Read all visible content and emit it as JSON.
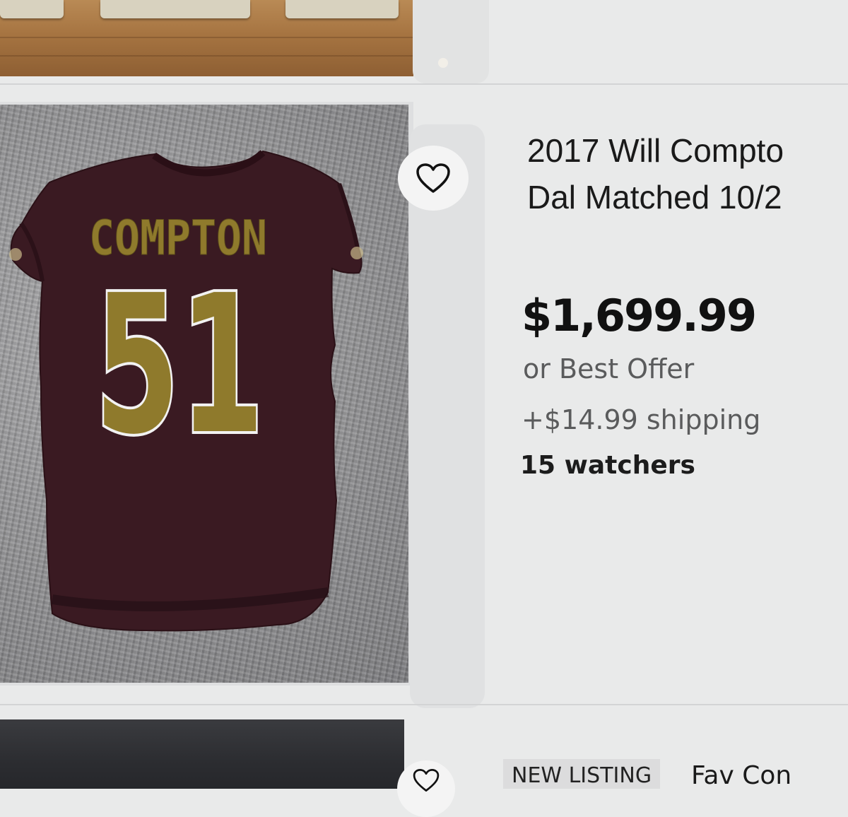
{
  "listing": {
    "title_line1": "2017 Will Compto",
    "title_line2": "Dal Matched 10/2",
    "price": "$1,699.99",
    "offer": "or Best Offer",
    "shipping": "+$14.99 shipping",
    "watchers": "15 watchers",
    "jersey_name": "COMPTON",
    "jersey_number": "51"
  },
  "next_listing": {
    "badge": "NEW LISTING",
    "title": "Fav Con"
  },
  "colors": {
    "jersey_body": "#3a1a22",
    "numeral_gold": "#8f7a2c",
    "price_text": "#111111",
    "secondary_text": "#5a5b5c"
  },
  "icons": {
    "watch": "heart-icon"
  }
}
